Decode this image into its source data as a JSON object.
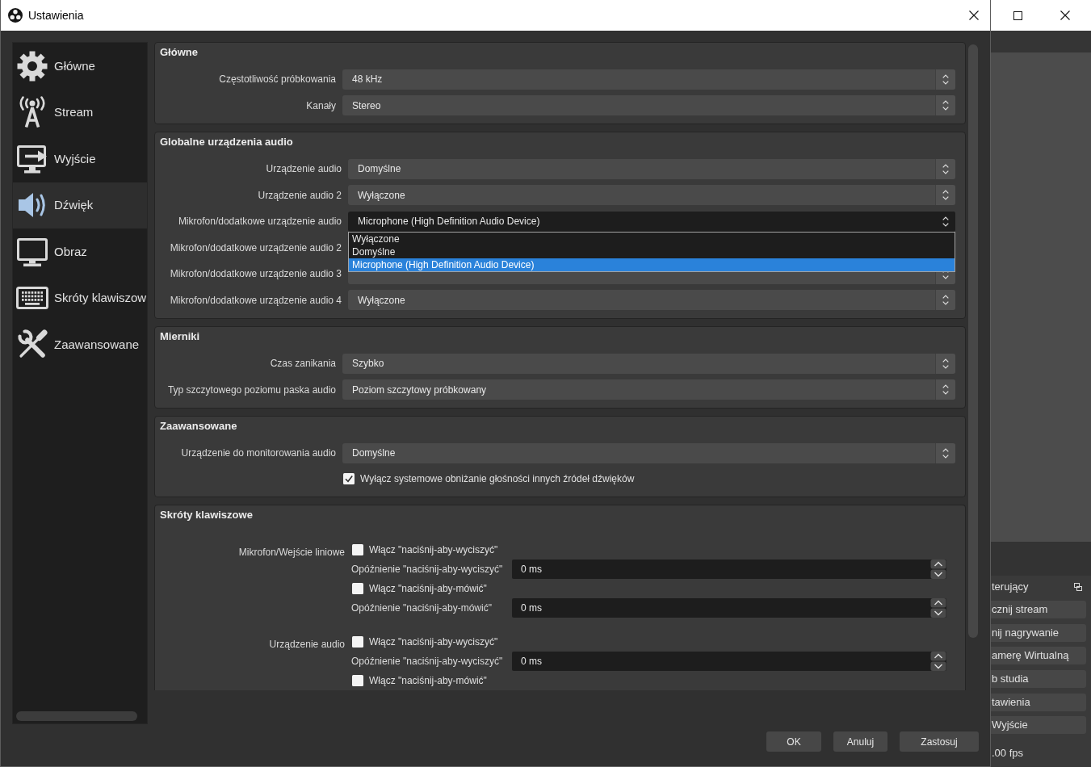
{
  "window": {
    "title": "Ustawienia"
  },
  "sidebar": {
    "items": [
      {
        "label": "Główne",
        "selected": false
      },
      {
        "label": "Stream",
        "selected": false
      },
      {
        "label": "Wyjście",
        "selected": false
      },
      {
        "label": "Dźwięk",
        "selected": true
      },
      {
        "label": "Obraz",
        "selected": false
      },
      {
        "label": "Skróty klawiszow",
        "selected": false
      },
      {
        "label": "Zaawansowane",
        "selected": false
      }
    ]
  },
  "sections": [
    {
      "title": "Główne",
      "rows": [
        {
          "kind": "combo",
          "label": "Częstotliwość próbkowania",
          "value": "48 kHz",
          "expanded": false
        },
        {
          "kind": "combo",
          "label": "Kanały",
          "value": "Stereo",
          "expanded": false
        }
      ]
    },
    {
      "title": "Globalne urządzenia audio",
      "rows": [
        {
          "kind": "combo",
          "label": "Urządzenie audio",
          "value": "Domyślne",
          "expanded": false
        },
        {
          "kind": "combo",
          "label": "Urządzenie audio 2",
          "value": "Wyłączone",
          "expanded": false
        },
        {
          "kind": "combo",
          "label": "Mikrofon/dodatkowe urządzenie audio",
          "value": "Microphone (High Definition Audio Device)",
          "expanded": true,
          "options": [
            {
              "label": "Wyłączone",
              "selected": false
            },
            {
              "label": "Domyślne",
              "selected": false
            },
            {
              "label": "Microphone (High Definition Audio Device)",
              "selected": true
            }
          ]
        },
        {
          "kind": "label",
          "label": "Mikrofon/dodatkowe urządzenie audio 2"
        },
        {
          "kind": "combo",
          "label": "Mikrofon/dodatkowe urządzenie audio 3",
          "expanded": false
        },
        {
          "kind": "combo",
          "label": "Mikrofon/dodatkowe urządzenie audio 4",
          "value": "Wyłączone",
          "expanded": false
        }
      ]
    },
    {
      "title": "Mierniki",
      "rows": [
        {
          "kind": "combo",
          "label": "Czas zanikania",
          "value": "Szybko",
          "expanded": false
        },
        {
          "kind": "combo",
          "label": "Typ szczytowego poziomu paska audio",
          "value": "Poziom szczytowy próbkowany",
          "expanded": false
        }
      ]
    },
    {
      "title": "Zaawansowane",
      "rows": [
        {
          "kind": "combo",
          "label": "Urządzenie do monitorowania audio",
          "value": "Domyślne",
          "expanded": false
        },
        {
          "kind": "checkbox",
          "label": "Wyłącz systemowe obniżanie głośności innych źródeł dźwięków",
          "checked": true
        }
      ]
    },
    {
      "title": "Skróty klawiszowe",
      "groups": [
        {
          "label": "Mikrofon/Wejście liniowe",
          "controls": [
            {
              "kind": "checkbox",
              "label": "Włącz \"naciśnij-aby-wyciszyć\"",
              "checked": false
            },
            {
              "kind": "spin",
              "label": "Opóźnienie \"naciśnij-aby-wyciszyć\"",
              "value": "0 ms"
            },
            {
              "kind": "checkbox",
              "label": "Włącz \"naciśnij-aby-mówić\"",
              "checked": false
            },
            {
              "kind": "spin",
              "label": "Opóźnienie \"naciśnij-aby-mówić\"",
              "value": "0 ms"
            }
          ]
        },
        {
          "label": "Urządzenie audio",
          "controls": [
            {
              "kind": "checkbox",
              "label": "Włącz \"naciśnij-aby-wyciszyć\"",
              "checked": false
            },
            {
              "kind": "spin",
              "label": "Opóźnienie \"naciśnij-aby-wyciszyć\"",
              "value": "0 ms"
            },
            {
              "kind": "checkbox",
              "label": "Włącz \"naciśnij-aby-mówić\"",
              "checked": false
            }
          ]
        }
      ]
    }
  ],
  "buttons": [
    {
      "label": "OK"
    },
    {
      "label": "Anuluj"
    },
    {
      "label": "Zastosuj"
    }
  ],
  "background_window": {
    "dock_title": "terujący",
    "buttons": [
      "cznij stream",
      "nij nagrywanie",
      "amerę Wirtualną",
      "b studia",
      "tawienia",
      "Wyjście"
    ],
    "status": ".00 fps"
  }
}
